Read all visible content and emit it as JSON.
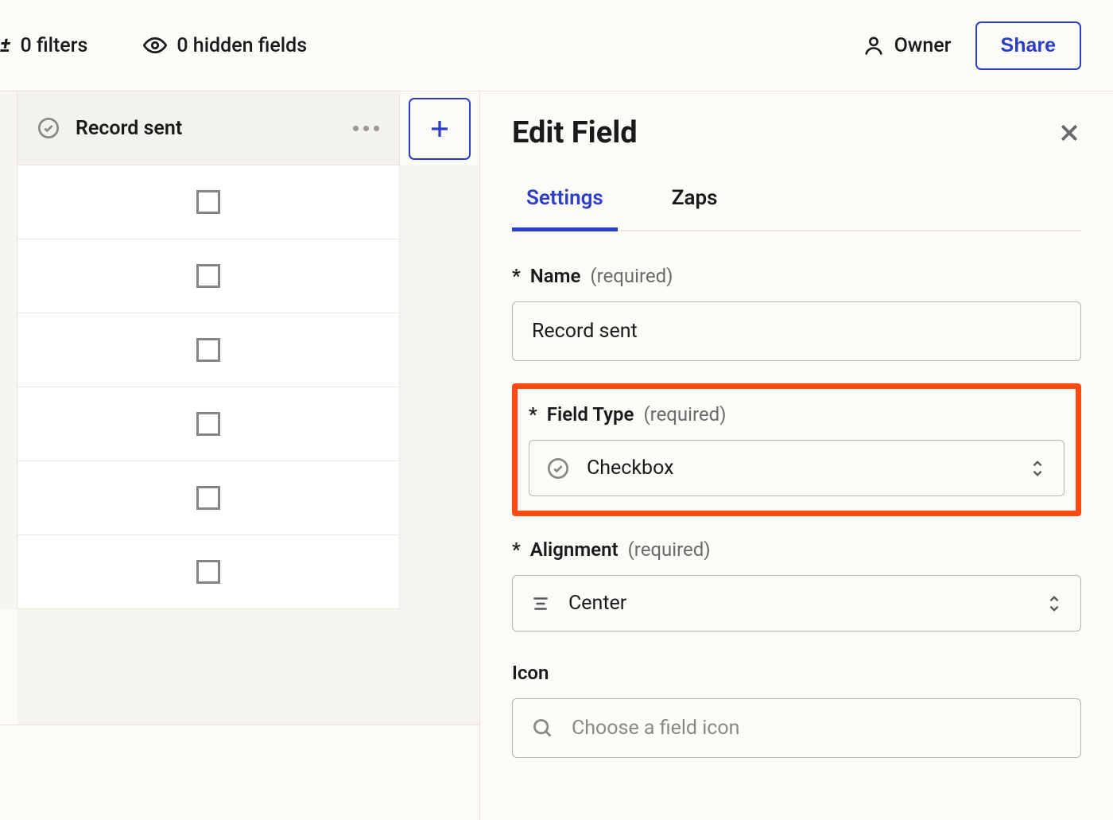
{
  "toolbar": {
    "filters_label": "0 filters",
    "hidden_fields_label": "0 hidden fields",
    "owner_label": "Owner",
    "share_label": "Share"
  },
  "column": {
    "header": "Record sent",
    "rows": [
      false,
      false,
      false,
      false,
      false,
      false
    ]
  },
  "panel": {
    "title": "Edit Field",
    "tabs": [
      {
        "label": "Settings",
        "active": true
      },
      {
        "label": "Zaps",
        "active": false
      }
    ],
    "name_field": {
      "label": "Name",
      "required_text": "(required)",
      "value": "Record sent"
    },
    "type_field": {
      "label": "Field Type",
      "required_text": "(required)",
      "value": "Checkbox"
    },
    "alignment_field": {
      "label": "Alignment",
      "required_text": "(required)",
      "value": "Center"
    },
    "icon_field": {
      "label": "Icon",
      "placeholder": "Choose a field icon"
    }
  }
}
